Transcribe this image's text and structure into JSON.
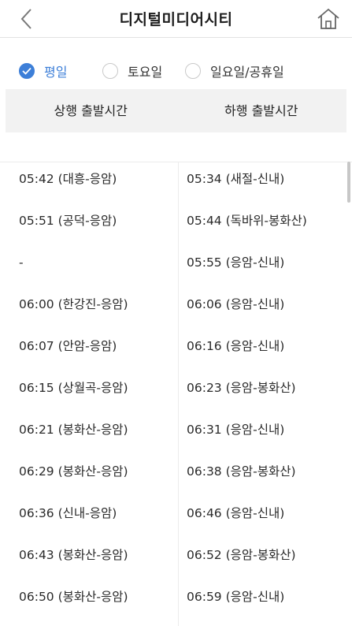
{
  "header": {
    "title": "디지털미디어시티",
    "back_icon": "chevron-left-icon",
    "home_icon": "home-icon"
  },
  "day_tabs": [
    {
      "label": "평일",
      "selected": true
    },
    {
      "label": "토요일",
      "selected": false
    },
    {
      "label": "일요일/공휴일",
      "selected": false
    }
  ],
  "columns": {
    "up": "상행 출발시간",
    "down": "하행 출발시간"
  },
  "accent_color": "#3d7fd8",
  "up_times": [
    "05:42 (대흥-응암)",
    "05:51 (공덕-응암)",
    "-",
    "06:00 (한강진-응암)",
    "06:07 (안암-응암)",
    "06:15 (상월곡-응암)",
    "06:21 (봉화산-응암)",
    "06:29 (봉화산-응암)",
    "06:36 (신내-응암)",
    "06:43 (봉화산-응암)",
    "06:50 (봉화산-응암)"
  ],
  "down_times": [
    "05:34 (새절-신내)",
    "05:44 (독바위-봉화산)",
    "05:55 (응암-신내)",
    "06:06 (응암-신내)",
    "06:16 (응암-신내)",
    "06:23 (응암-봉화산)",
    "06:31 (응암-신내)",
    "06:38 (응암-봉화산)",
    "06:46 (응암-신내)",
    "06:52 (응암-봉화산)",
    "06:59 (응암-신내)"
  ]
}
